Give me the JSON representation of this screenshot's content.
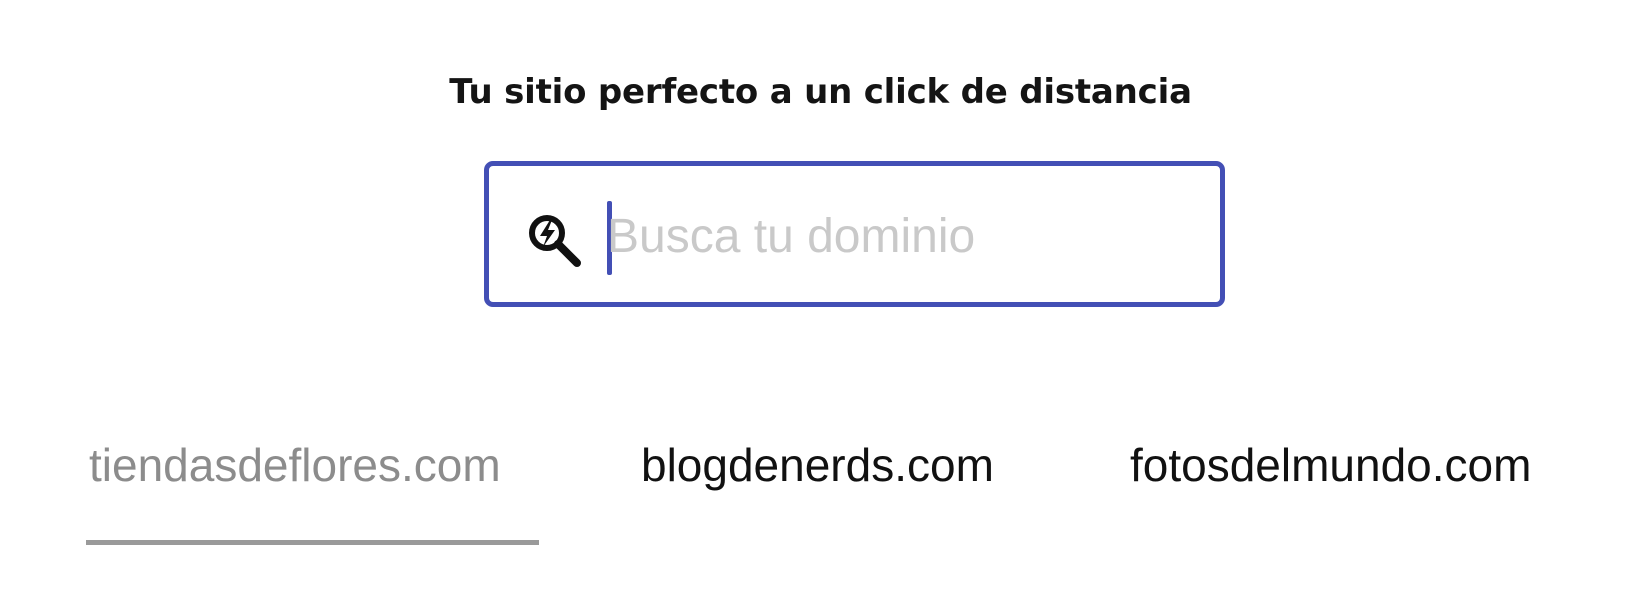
{
  "headline": "Tu sitio perfecto a un click de distancia",
  "search": {
    "placeholder": "Busca tu dominio",
    "value": "",
    "icon": "search-bolt-icon",
    "accent_color": "#434fb5"
  },
  "domain_tabs": [
    {
      "label": "tiendasdeflores.com",
      "active": true
    },
    {
      "label": "blogdenerds.com",
      "active": false
    },
    {
      "label": "fotosdelmundo.com",
      "active": false
    }
  ],
  "colors": {
    "active_tab_text": "#8c8c8c",
    "inactive_tab_text": "#111111",
    "underline": "#9a9a9a",
    "placeholder": "#c9c9c9"
  }
}
